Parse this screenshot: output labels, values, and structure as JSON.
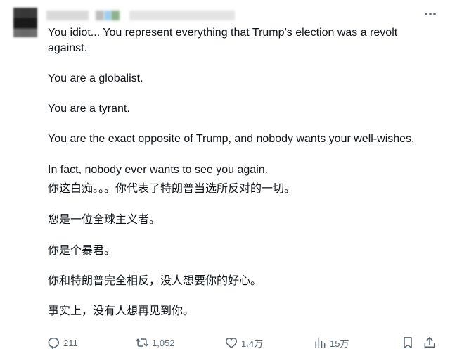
{
  "post": {
    "paragraphs": {
      "en1": "You idiot... You represent everything that Trump’s election was a revolt against.",
      "en2": "You are a globalist.",
      "en3": "You are a tyrant.",
      "en4": "You are the exact opposite of Trump, and nobody wants your well-wishes.",
      "en5": "In fact, nobody ever wants to see you again.",
      "zh1": "你这白痴。。。你代表了特朗普当选所反对的一切。",
      "zh2": "您是一位全球主义者。",
      "zh3": "你是个暴君。",
      "zh4": "你和特朗普完全相反，没人想要你的好心。",
      "zh5": "事实上，没有人想再见到你。"
    }
  },
  "actions": {
    "replies": "211",
    "reposts": "1,052",
    "likes": "1.4万",
    "views": "15万"
  },
  "icons": {
    "more": "more-horizontal-icon",
    "reply": "reply-icon",
    "repost": "repost-icon",
    "like": "heart-icon",
    "views": "views-chart-icon",
    "bookmark": "bookmark-icon",
    "share": "share-icon"
  },
  "colors": {
    "text": "#0f1419",
    "muted": "#536471"
  }
}
